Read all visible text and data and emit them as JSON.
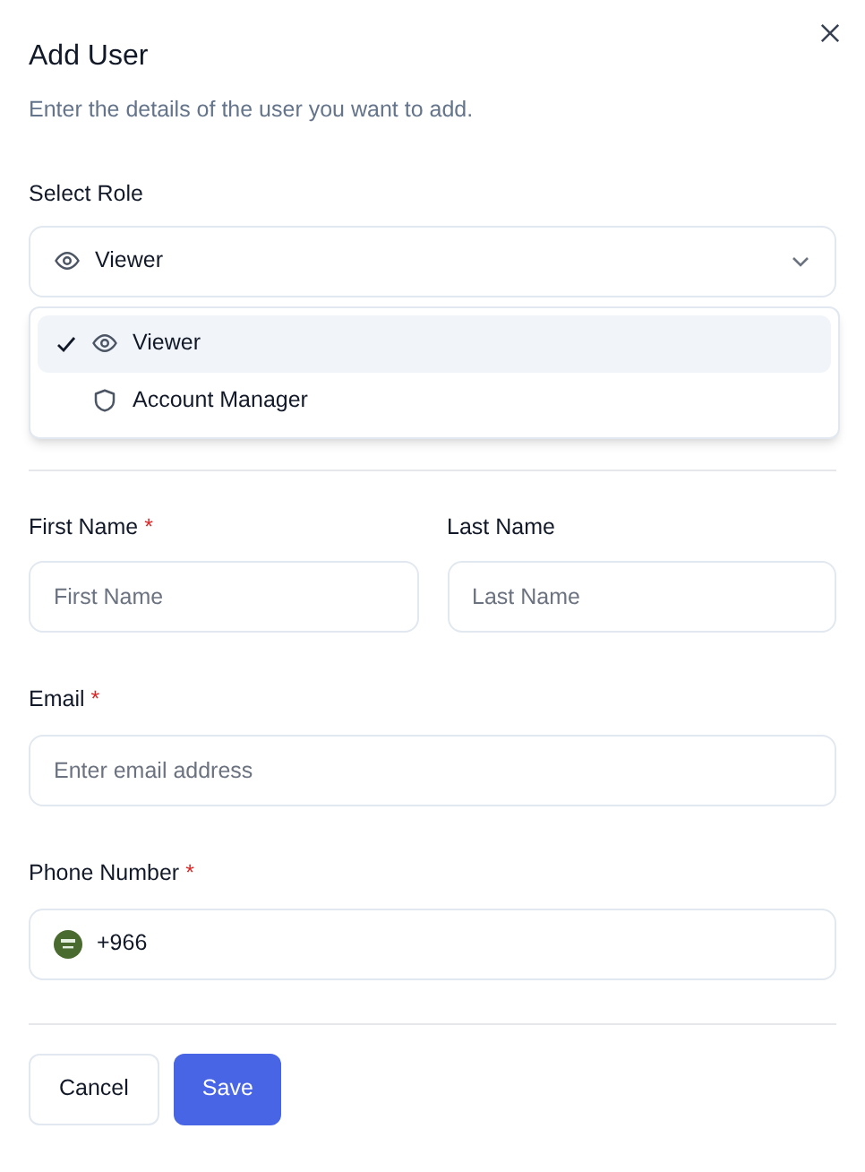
{
  "dialog": {
    "title": "Add User",
    "description": "Enter the details of the user you want to add."
  },
  "role": {
    "label": "Select Role",
    "value": "Viewer",
    "expanded": true,
    "options": [
      {
        "label": "Viewer",
        "selected": true
      },
      {
        "label": "Account Manager",
        "selected": false
      }
    ]
  },
  "fields": [
    {
      "label": "First Name",
      "required_mark": "*",
      "placeholder": "First Name"
    },
    {
      "label": "Last Name",
      "placeholder": "Last Name"
    },
    {
      "label": "Email",
      "required_mark": "*",
      "placeholder": "Enter email address"
    },
    {
      "label": "Phone Number",
      "required_mark": "*",
      "value": "+966"
    }
  ],
  "buttons": {
    "cancel": "Cancel",
    "save": "Save"
  }
}
